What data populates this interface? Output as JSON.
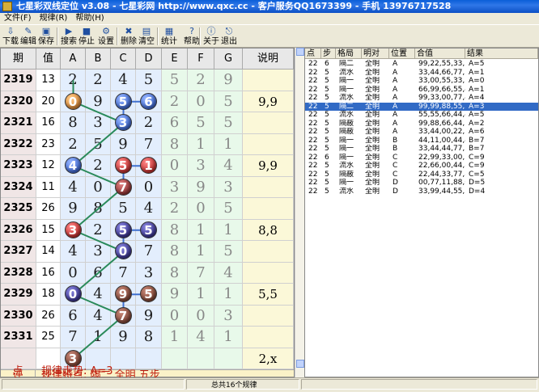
{
  "window": {
    "title": "七星彩双线定位 v3.08 - 七星彩网 http://www.qxc.cc - 客户服务QQ1673399 - 手机 13976717528"
  },
  "menu": [
    "文件(F)",
    "规律(R)",
    "帮助(H)"
  ],
  "toolbar": [
    {
      "label": "下载",
      "icon": "download-icon"
    },
    {
      "label": "编辑",
      "icon": "edit-icon"
    },
    {
      "label": "保存",
      "icon": "save-icon"
    },
    {
      "label": "搜索",
      "icon": "search-icon"
    },
    {
      "label": "停止",
      "icon": "stop-icon"
    },
    {
      "label": "设置",
      "icon": "settings-icon"
    },
    {
      "label": "删除",
      "icon": "delete-icon"
    },
    {
      "label": "清空",
      "icon": "clear-icon"
    },
    {
      "label": "统计",
      "icon": "stats-icon"
    },
    {
      "label": "帮助",
      "icon": "help-icon"
    },
    {
      "label": "关于",
      "icon": "about-icon"
    },
    {
      "label": "退出",
      "icon": "exit-icon"
    }
  ],
  "grid": {
    "headers": [
      "期",
      "值",
      "A",
      "B",
      "C",
      "D",
      "E",
      "F",
      "G",
      "说明"
    ],
    "rows": [
      {
        "period": "2319",
        "value": "13",
        "digits": [
          "2",
          "2",
          "4",
          "5",
          "5",
          "2",
          "9"
        ],
        "note": ""
      },
      {
        "period": "2320",
        "value": "20",
        "digits": [
          "0",
          "9",
          "5",
          "6",
          "2",
          "0",
          "5"
        ],
        "note": "9,9"
      },
      {
        "period": "2321",
        "value": "16",
        "digits": [
          "8",
          "3",
          "3",
          "2",
          "6",
          "5",
          "5"
        ],
        "note": ""
      },
      {
        "period": "2322",
        "value": "23",
        "digits": [
          "2",
          "5",
          "9",
          "7",
          "8",
          "1",
          "1"
        ],
        "note": ""
      },
      {
        "period": "2323",
        "value": "12",
        "digits": [
          "4",
          "2",
          "5",
          "1",
          "0",
          "3",
          "4"
        ],
        "note": "9,9"
      },
      {
        "period": "2324",
        "value": "11",
        "digits": [
          "4",
          "0",
          "7",
          "0",
          "3",
          "9",
          "3"
        ],
        "note": ""
      },
      {
        "period": "2325",
        "value": "26",
        "digits": [
          "9",
          "8",
          "5",
          "4",
          "2",
          "0",
          "5"
        ],
        "note": ""
      },
      {
        "period": "2326",
        "value": "15",
        "digits": [
          "3",
          "2",
          "5",
          "5",
          "8",
          "1",
          "1"
        ],
        "note": "8,8"
      },
      {
        "period": "2327",
        "value": "14",
        "digits": [
          "4",
          "3",
          "0",
          "7",
          "8",
          "1",
          "5"
        ],
        "note": ""
      },
      {
        "period": "2328",
        "value": "16",
        "digits": [
          "0",
          "6",
          "7",
          "3",
          "8",
          "7",
          "4"
        ],
        "note": ""
      },
      {
        "period": "2329",
        "value": "18",
        "digits": [
          "0",
          "4",
          "9",
          "5",
          "9",
          "1",
          "1"
        ],
        "note": "5,5"
      },
      {
        "period": "2330",
        "value": "26",
        "digits": [
          "6",
          "4",
          "7",
          "9",
          "0",
          "0",
          "3"
        ],
        "note": ""
      },
      {
        "period": "2331",
        "value": "25",
        "digits": [
          "7",
          "1",
          "9",
          "8",
          "1",
          "4",
          "1"
        ],
        "note": ""
      },
      {
        "period": "",
        "value": "",
        "digits": [
          "3",
          "",
          "",
          "",
          "",
          "",
          ""
        ],
        "note": "2,x"
      }
    ],
    "balls": [
      {
        "row": 1,
        "col": 0,
        "color": "orange"
      },
      {
        "row": 1,
        "col": 2,
        "color": "blue"
      },
      {
        "row": 1,
        "col": 3,
        "color": "blue"
      },
      {
        "row": 2,
        "col": 2,
        "color": "blue"
      },
      {
        "row": 4,
        "col": 0,
        "color": "blue"
      },
      {
        "row": 4,
        "col": 2,
        "color": "red"
      },
      {
        "row": 4,
        "col": 3,
        "color": "red"
      },
      {
        "row": 5,
        "col": 2,
        "color": "maroon"
      },
      {
        "row": 7,
        "col": 0,
        "color": "red"
      },
      {
        "row": 7,
        "col": 2,
        "color": "navy"
      },
      {
        "row": 7,
        "col": 3,
        "color": "navy"
      },
      {
        "row": 8,
        "col": 2,
        "color": "navy"
      },
      {
        "row": 10,
        "col": 0,
        "color": "navy"
      },
      {
        "row": 10,
        "col": 2,
        "color": "brown"
      },
      {
        "row": 10,
        "col": 3,
        "color": "brown"
      },
      {
        "row": 11,
        "col": 2,
        "color": "brown"
      },
      {
        "row": 13,
        "col": 0,
        "color": "brown"
      }
    ]
  },
  "footer": {
    "label1": "点",
    "text1": "规律走势: A=3",
    "label2": "评",
    "text2": "规律特点: 隔二 全明 五步"
  },
  "list": {
    "headers": [
      "点",
      "步",
      "格局",
      "明对",
      "位置",
      "合值",
      "结果"
    ],
    "rows": [
      [
        "22",
        "6",
        "隔二",
        "全明",
        "A",
        "99,22,55,33,...",
        "A=5"
      ],
      [
        "22",
        "5",
        "流水",
        "全明",
        "A",
        "33,44,66,77,7x",
        "A=1"
      ],
      [
        "22",
        "5",
        "隔一",
        "全明",
        "A",
        "33,00,55,33,7x",
        "A=0"
      ],
      [
        "22",
        "5",
        "隔一",
        "全明",
        "A",
        "66,99,66,55,4x",
        "A=1"
      ],
      [
        "22",
        "5",
        "流水",
        "全明",
        "A",
        "99,33,00,77,4x",
        "A=4"
      ],
      [
        "22",
        "5",
        "隔二",
        "全明",
        "A",
        "99,99,88,55,2x",
        "A=3"
      ],
      [
        "22",
        "5",
        "流水",
        "全明",
        "A",
        "55,55,66,44,4x",
        "A=5"
      ],
      [
        "22",
        "5",
        "隔蔽",
        "全明",
        "A",
        "99,88,66,44,7x",
        "A=2"
      ],
      [
        "22",
        "5",
        "隔蔽",
        "全明",
        "A",
        "33,44,00,22,5x",
        "A=6"
      ],
      [
        "22",
        "5",
        "隔一",
        "全明",
        "B",
        "44,11,00,44,4x",
        "B=7"
      ],
      [
        "22",
        "5",
        "隔一",
        "全明",
        "B",
        "33,44,44,77,1x",
        "B=7"
      ],
      [
        "22",
        "6",
        "隔一",
        "全明",
        "C",
        "22,99,33,00,...",
        "C=9"
      ],
      [
        "22",
        "5",
        "流水",
        "全明",
        "C",
        "22,66,00,44,8x",
        "C=9"
      ],
      [
        "22",
        "5",
        "隔蔽",
        "全明",
        "C",
        "22,44,33,77,8x",
        "C=5"
      ],
      [
        "22",
        "5",
        "隔一",
        "全明",
        "D",
        "00,77,11,88,6x",
        "D=5"
      ],
      [
        "22",
        "5",
        "流水",
        "全明",
        "D",
        "33,99,44,55,7x",
        "D=4"
      ]
    ],
    "selected_index": 5
  },
  "status": {
    "text": "总共16个规律"
  }
}
